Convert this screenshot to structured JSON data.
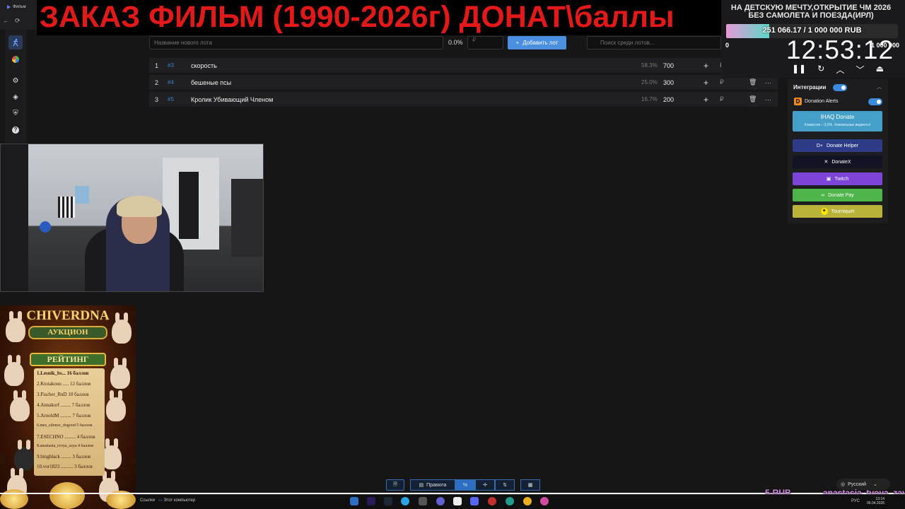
{
  "browser": {
    "tab_label": "Фильм",
    "nav": [
      "←",
      "⟳"
    ]
  },
  "overlay": {
    "title": "ЗАКАЗ ФИЛЬМ (1990-2026г) ДОНАТ\\баллы"
  },
  "sidebar": {
    "items": [
      {
        "icon": "runner-icon"
      },
      {
        "icon": "wheel-icon"
      },
      {
        "icon": "gear-icon"
      },
      {
        "icon": "layers-icon"
      },
      {
        "icon": "shield-icon"
      },
      {
        "icon": "help-icon"
      }
    ]
  },
  "lot_form": {
    "name_placeholder": "Название нового лота",
    "percent": "0.0%",
    "amount_placeholder": "₽",
    "add_label": "Добавить лот",
    "search_placeholder": "Поиск среди лотов..."
  },
  "lots": [
    {
      "num": "1",
      "id": "#3",
      "name": "скорость",
      "percent": "58.3%",
      "amount": "700",
      "currency": "₽"
    },
    {
      "num": "2",
      "id": "#4",
      "name": "бешеные псы",
      "percent": "25.0%",
      "amount": "300",
      "currency": "₽"
    },
    {
      "num": "3",
      "id": "#5",
      "name": "Кролик Убивающий Членом",
      "percent": "16.7%",
      "amount": "200",
      "currency": "₽"
    }
  ],
  "goal": {
    "title": "НА ДЕТСКУЮ МЕЧТУ,ОТКРЫТИЕ ЧМ 2026 БЕЗ САМОЛЕТА И ПОЕЗДА(ИРЛ)",
    "progress_text": "251 066.17 / 1 000 000 RUB",
    "progress_fraction": 0.251,
    "min": "0",
    "max": "1 000 000",
    "fill_colors": [
      "#e79ad6",
      "#5cd6c9"
    ]
  },
  "timer": {
    "clock": "12:53:12",
    "controls": [
      "pause-icon",
      "restart-icon",
      "chevron-up-icon",
      "chevron-down-icon",
      "collapse-icon"
    ]
  },
  "integrations": {
    "title": "Интеграции",
    "donation_alerts": "Donation Alerts",
    "ihaq": {
      "title": "IHAQ Donate",
      "subtitle": "Комиссия – 3,5%. Уникальные виджеты!"
    },
    "services": [
      {
        "label": "Donate Helper",
        "color": "#2e3b86"
      },
      {
        "label": "DonateX",
        "color": "#121426"
      },
      {
        "label": "Twitch",
        "color": "#7c45d8"
      },
      {
        "label": "Donate Pay",
        "color": "#4db54a"
      },
      {
        "label": "Tourniquet",
        "color": "#b9b33a"
      }
    ]
  },
  "poster": {
    "title": "CHIVERDNA",
    "subtitle": "АУКЦИОН",
    "rating_label": "РЕЙТИНГ",
    "rows": [
      "1.Lesnik_bs... 16 баллов",
      "2.Ktotakouu ..... 12 баллов",
      "3.Fischer_RnD 10 баллов",
      "4.Annakorf ........ 7 баллов",
      "5.ArnoldM ......... 7 баллов",
      "6.mes_silence_dogood 5 баллов",
      "7.ESECHNO ......... 4 баллов",
      "8.anastasia_tvoya_zaya 4 баллов",
      "9.bingblack ........ 3 баллов",
      "10.vor1823 .......... 3 баллов"
    ]
  },
  "bottom_toolbar": {
    "rules_label": "Правила",
    "language": "Русский"
  },
  "taskbar": {
    "links": "Ссылки",
    "computer": "Этот компьютер",
    "lang": "РУС",
    "time": "13:14",
    "date": "06.04.2026"
  },
  "ticker": {
    "amount": "5-RUB",
    "name": "anastasia_tvoya_zaya"
  }
}
